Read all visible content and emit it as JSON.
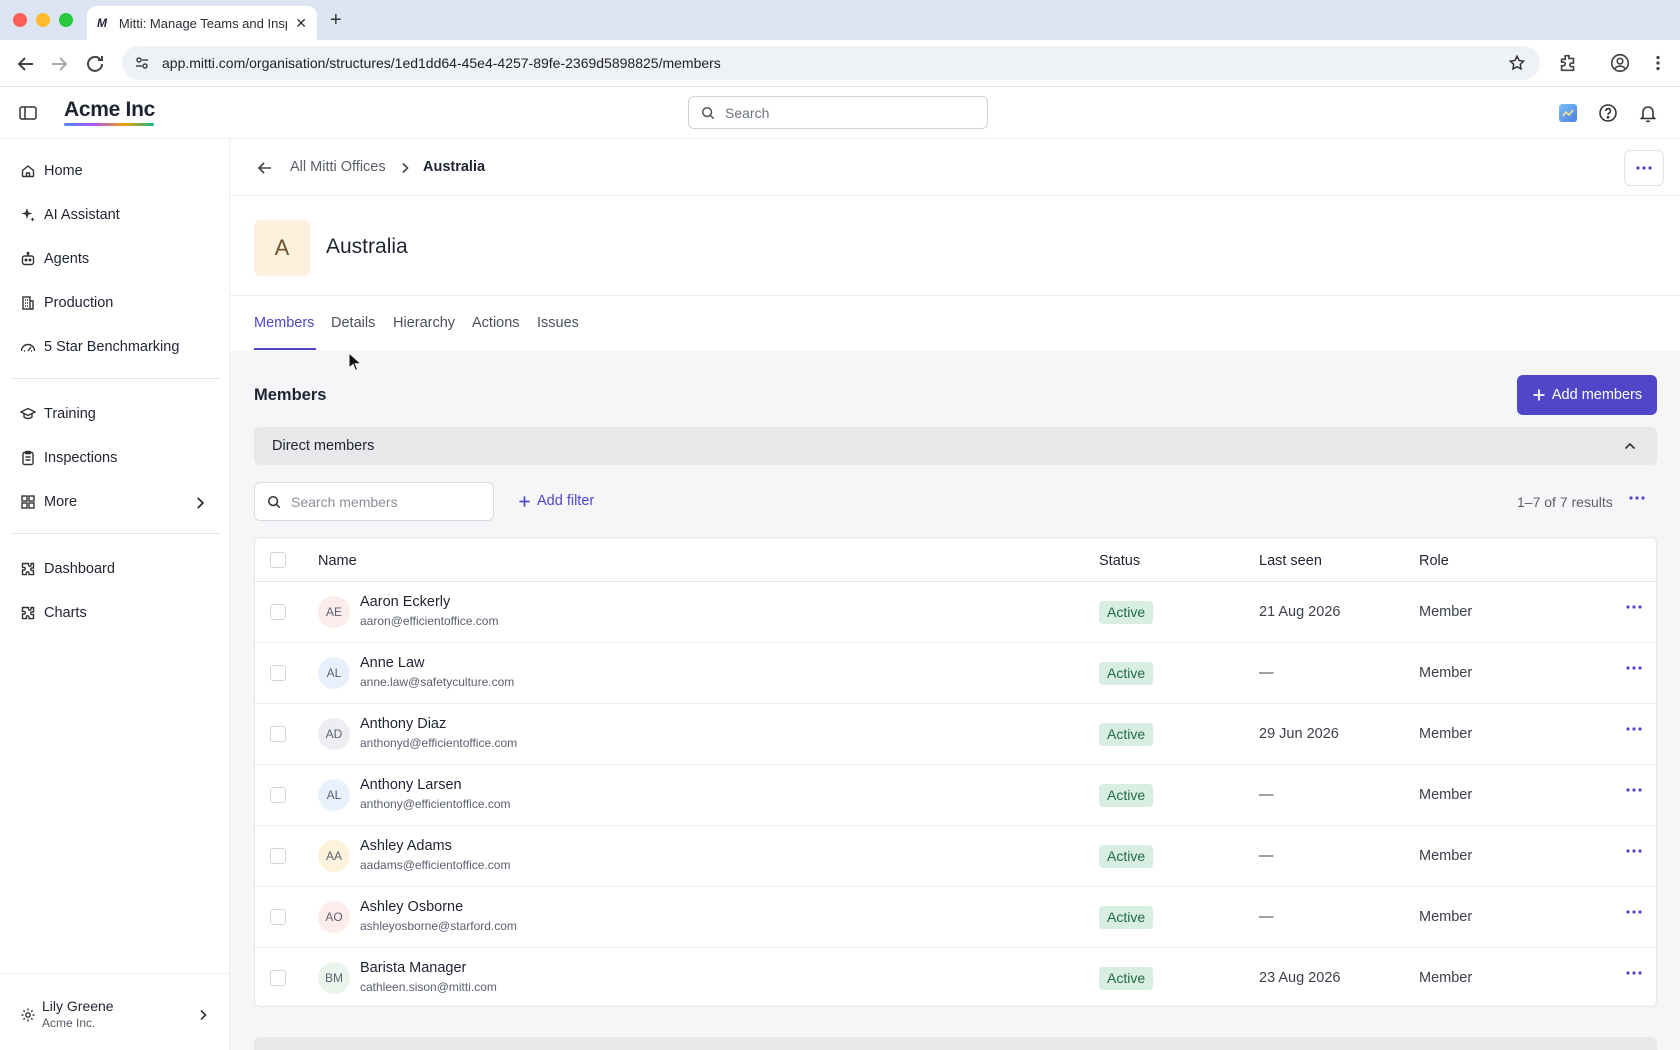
{
  "browser": {
    "tab_title": "Mitti: Manage Teams and Inspections",
    "tab_favicon": "M",
    "url": "app.mitti.com/organisation/structures/1ed1dd64-45e4-4257-89fe-2369d5898825/members"
  },
  "header": {
    "brand": "Acme Inc",
    "search_placeholder": "Search"
  },
  "sidebar": {
    "items": [
      {
        "label": "Home",
        "icon": "home-icon"
      },
      {
        "label": "AI Assistant",
        "icon": "sparkle-icon"
      },
      {
        "label": "Agents",
        "icon": "robot-icon"
      },
      {
        "label": "Production",
        "icon": "building-icon"
      },
      {
        "label": "5 Star Benchmarking",
        "icon": "gauge-icon"
      },
      {
        "label": "Training",
        "icon": "graduation-cap-icon"
      },
      {
        "label": "Inspections",
        "icon": "clipboard-icon"
      },
      {
        "label": "More",
        "icon": "grid-icon"
      },
      {
        "label": "Dashboard",
        "icon": "puzzle-icon"
      },
      {
        "label": "Charts",
        "icon": "puzzle-icon"
      }
    ],
    "user": {
      "name": "Lily Greene",
      "org": "Acme Inc."
    }
  },
  "breadcrumb": {
    "parent": "All Mitti Offices",
    "current": "Australia"
  },
  "page": {
    "avatar_letter": "A",
    "title": "Australia",
    "tabs": [
      "Members",
      "Details",
      "Hierarchy",
      "Actions",
      "Issues"
    ],
    "active_tab": "Members"
  },
  "members": {
    "section_title": "Members",
    "add_button": "Add members",
    "group_label": "Direct members",
    "search_placeholder": "Search members",
    "add_filter": "Add filter",
    "results": "1–7 of 7 results",
    "columns": {
      "name": "Name",
      "status": "Status",
      "last_seen": "Last seen",
      "role": "Role"
    },
    "rows": [
      {
        "initials": "AE",
        "name": "Aaron Eckerly",
        "email": "aaron@efficientoffice.com",
        "status": "Active",
        "last_seen": "21 Aug 2026",
        "role": "Member",
        "avatar_bg": "#fdecec"
      },
      {
        "initials": "AL",
        "name": "Anne Law",
        "email": "anne.law@safetyculture.com",
        "status": "Active",
        "last_seen": "—",
        "role": "Member",
        "avatar_bg": "#e8f1fb"
      },
      {
        "initials": "AD",
        "name": "Anthony Diaz",
        "email": "anthonyd@efficientoffice.com",
        "status": "Active",
        "last_seen": "29 Jun 2026",
        "role": "Member",
        "avatar_bg": "#eeeef2"
      },
      {
        "initials": "AL",
        "name": "Anthony Larsen",
        "email": "anthony@efficientoffice.com",
        "status": "Active",
        "last_seen": "—",
        "role": "Member",
        "avatar_bg": "#e8f1fb"
      },
      {
        "initials": "AA",
        "name": "Ashley Adams",
        "email": "aadams@efficientoffice.com",
        "status": "Active",
        "last_seen": "—",
        "role": "Member",
        "avatar_bg": "#fdf3dc"
      },
      {
        "initials": "AO",
        "name": "Ashley Osborne",
        "email": "ashleyosborne@starford.com",
        "status": "Active",
        "last_seen": "—",
        "role": "Member",
        "avatar_bg": "#fdecec"
      },
      {
        "initials": "BM",
        "name": "Barista Manager",
        "email": "cathleen.sison@mitti.com",
        "status": "Active",
        "last_seen": "23 Aug 2026",
        "role": "Member",
        "avatar_bg": "#e9f5ec"
      }
    ]
  },
  "colors": {
    "accent": "#4f46c8",
    "active_badge_bg": "#d9eee2",
    "active_badge_text": "#1f6b43"
  }
}
